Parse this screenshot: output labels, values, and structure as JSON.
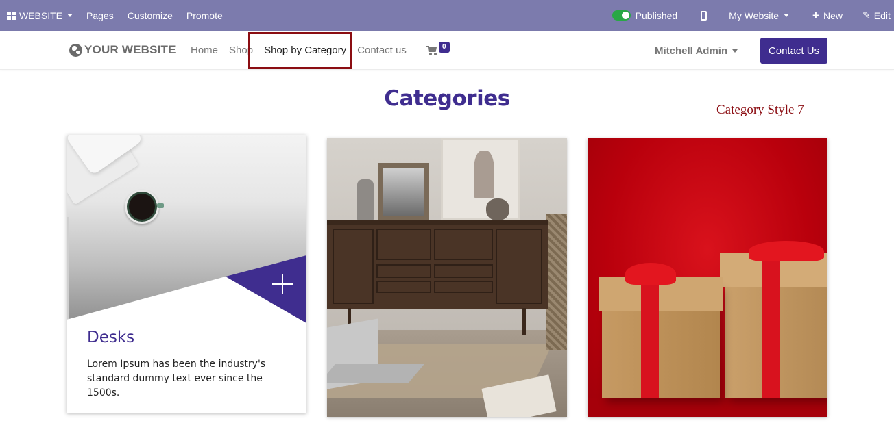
{
  "adminbar": {
    "app_label": "WEBSITE",
    "menu": [
      "Pages",
      "Customize",
      "Promote"
    ],
    "published_label": "Published",
    "published": true,
    "website_selector": "My Website",
    "new_label": "New",
    "edit_label": "Edit"
  },
  "header": {
    "logo_text": "YOUR WEBSITE",
    "nav": {
      "home": "Home",
      "shop": "Shop",
      "shop_by_category": "Shop by Category",
      "contact": "Contact us"
    },
    "cart_count": "0",
    "user_name": "Mitchell Admin",
    "cta_label": "Contact Us"
  },
  "main": {
    "title": "Categories",
    "annotation": "Category Style 7",
    "cards": [
      {
        "title": "Desks",
        "description": "Lorem Ipsum has been the industry's standard dummy text ever since the 1500s."
      }
    ]
  },
  "colors": {
    "admin_bar": "#7c7bad",
    "accent": "#3f2d8f",
    "highlight_box": "#8b0d12",
    "published_toggle": "#28a745"
  }
}
